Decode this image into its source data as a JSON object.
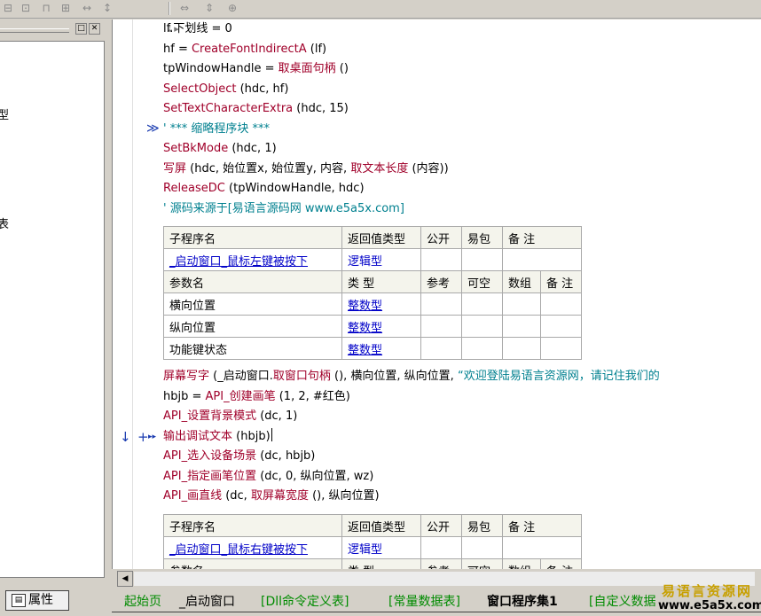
{
  "toolbar": {
    "icons": [
      "align-left-icon",
      "align-center-icon",
      "align-top-icon",
      "align-middle-icon",
      "space-horizontal-icon",
      "space-vertical-icon",
      "same-width-icon",
      "same-height-icon",
      "same-size-icon"
    ]
  },
  "left_panel": {
    "tree_fragments": [
      "型",
      "表"
    ],
    "properties_tab": "属性"
  },
  "code_lines_top": [
    {
      "segments": [
        {
          "t": "lf.下划线 = 0",
          "c": "k"
        }
      ]
    },
    {
      "segments": [
        {
          "t": "hf = ",
          "c": "k"
        },
        {
          "t": "CreateFontIndirectA",
          "c": "fn"
        },
        {
          "t": " (lf)",
          "c": "k"
        }
      ]
    },
    {
      "segments": [
        {
          "t": "tpWindowHandle = ",
          "c": "k"
        },
        {
          "t": "取桌面句柄",
          "c": "fn"
        },
        {
          "t": " ()",
          "c": "k"
        }
      ]
    },
    {
      "segments": [
        {
          "t": "SelectObject",
          "c": "fn"
        },
        {
          "t": " (hdc, hf)",
          "c": "k"
        }
      ]
    },
    {
      "segments": [
        {
          "t": "SetTextCharacterExtra",
          "c": "fn"
        },
        {
          "t": " (hdc, 15)",
          "c": "k"
        }
      ]
    },
    {
      "segments": [
        {
          "t": "' *** 缩略程序块 ***",
          "c": "cm"
        }
      ]
    },
    {
      "segments": [
        {
          "t": "SetBkMode",
          "c": "fn"
        },
        {
          "t": " (hdc, 1)",
          "c": "k"
        }
      ]
    },
    {
      "segments": [
        {
          "t": "写屏",
          "c": "fn"
        },
        {
          "t": " (hdc, 始位置x, 始位置y, 内容, ",
          "c": "k"
        },
        {
          "t": "取文本长度",
          "c": "fn"
        },
        {
          "t": " (内容))",
          "c": "k"
        }
      ]
    },
    {
      "segments": [
        {
          "t": "ReleaseDC",
          "c": "fn"
        },
        {
          "t": " (tpWindowHandle, hdc)",
          "c": "k"
        }
      ]
    },
    {
      "segments": [
        {
          "t": "' 源码来源于[易语言源码网 www.e5a5x.com]",
          "c": "cm"
        }
      ]
    }
  ],
  "table1": {
    "header": [
      "子程序名",
      "返回值类型",
      "公开",
      "易包",
      "备 注"
    ],
    "sub_row": [
      "_启动窗口_鼠标左键被按下",
      "逻辑型"
    ],
    "param_header": [
      "参数名",
      "类 型",
      "参考",
      "可空",
      "数组",
      "备 注"
    ],
    "params": [
      [
        "横向位置",
        "整数型"
      ],
      [
        "纵向位置",
        "整数型"
      ],
      [
        "功能键状态",
        "整数型"
      ]
    ]
  },
  "code_lines_mid": [
    {
      "segments": [
        {
          "t": "屏幕写字",
          "c": "fn"
        },
        {
          "t": " (_启动窗口.",
          "c": "k"
        },
        {
          "t": "取窗口句柄",
          "c": "fn"
        },
        {
          "t": " (), 横向位置, 纵向位置, ",
          "c": "k"
        },
        {
          "t": "“欢迎登陆易语言资源网，请记住我们的",
          "c": "cm"
        }
      ]
    },
    {
      "segments": [
        {
          "t": "hbjb = ",
          "c": "k"
        },
        {
          "t": "API_创建画笔",
          "c": "fn"
        },
        {
          "t": " (1, 2, #红色)",
          "c": "k"
        }
      ]
    },
    {
      "segments": [
        {
          "t": "API_设置背景模式",
          "c": "fn"
        },
        {
          "t": " (dc, 1)",
          "c": "k"
        }
      ]
    },
    {
      "segments": [
        {
          "t": "输出调试文本",
          "c": "fn"
        },
        {
          "t": " (hbjb)",
          "c": "k"
        }
      ]
    },
    {
      "segments": [
        {
          "t": "API_选入设备场景",
          "c": "fn"
        },
        {
          "t": " (dc, hbjb)",
          "c": "k"
        }
      ]
    },
    {
      "segments": [
        {
          "t": "API_指定画笔位置",
          "c": "fn"
        },
        {
          "t": " (dc, 0, 纵向位置, wz)",
          "c": "k"
        }
      ]
    },
    {
      "segments": [
        {
          "t": "API_画直线",
          "c": "fn"
        },
        {
          "t": " (dc, ",
          "c": "k"
        },
        {
          "t": "取屏幕宽度",
          "c": "fn"
        },
        {
          "t": " (), 纵向位置)",
          "c": "k"
        }
      ]
    }
  ],
  "table2": {
    "header": [
      "子程序名",
      "返回值类型",
      "公开",
      "易包",
      "备 注"
    ],
    "sub_row": [
      "_启动窗口_鼠标右键被按下",
      "逻辑型"
    ],
    "param_header": [
      "参数名",
      "类 型",
      "参考",
      "可空",
      "数组",
      "备 注"
    ]
  },
  "markers": {
    "breakpoint_arrow": "↓",
    "add": "+",
    "run_to": "▸▸",
    "collapse": "≫",
    "expand": "⇣▸"
  },
  "tabs": [
    {
      "label": "起始页",
      "style": "green"
    },
    {
      "label": "_启动窗口",
      "style": "normal"
    },
    {
      "label": "[Dll命令定义表]",
      "style": "green"
    },
    {
      "label": "[常量数据表]",
      "style": "green"
    },
    {
      "label": "窗口程序集1",
      "style": "active"
    },
    {
      "label": "[自定义数据",
      "style": "green"
    }
  ],
  "watermark": {
    "line1": "易语言资源网",
    "line2": "www.e5a5x.com"
  }
}
